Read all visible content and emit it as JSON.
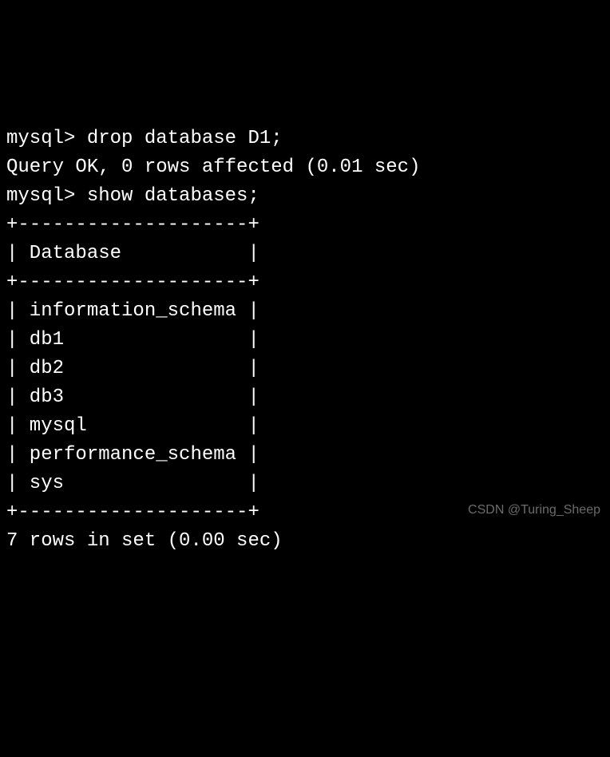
{
  "terminal": {
    "prompt": "mysql>",
    "lines": {
      "l1_prompt": "mysql> ",
      "l1_cmd": "drop database D1;",
      "l2": "Query OK, 0 rows affected (0.01 sec)",
      "l3": "",
      "l4_prompt": "mysql> ",
      "l4_cmd": "show databases;",
      "l5": "+--------------------+",
      "l6": "| Database           |",
      "l7": "+--------------------+",
      "l8": "| information_schema |",
      "l9": "| db1                |",
      "l10": "| db2                |",
      "l11": "| db3                |",
      "l12": "| mysql              |",
      "l13": "| performance_schema |",
      "l14": "| sys                |",
      "l15": "+--------------------+",
      "l16": "7 rows in set (0.00 sec)"
    }
  },
  "query_result_1": {
    "status": "Query OK",
    "rows_affected": 0,
    "time_sec": 0.01
  },
  "table": {
    "header": "Database",
    "rows": [
      "information_schema",
      "db1",
      "db2",
      "db3",
      "mysql",
      "performance_schema",
      "sys"
    ],
    "row_count": 7,
    "time_sec": 0.0
  },
  "watermark": "CSDN @Turing_Sheep"
}
